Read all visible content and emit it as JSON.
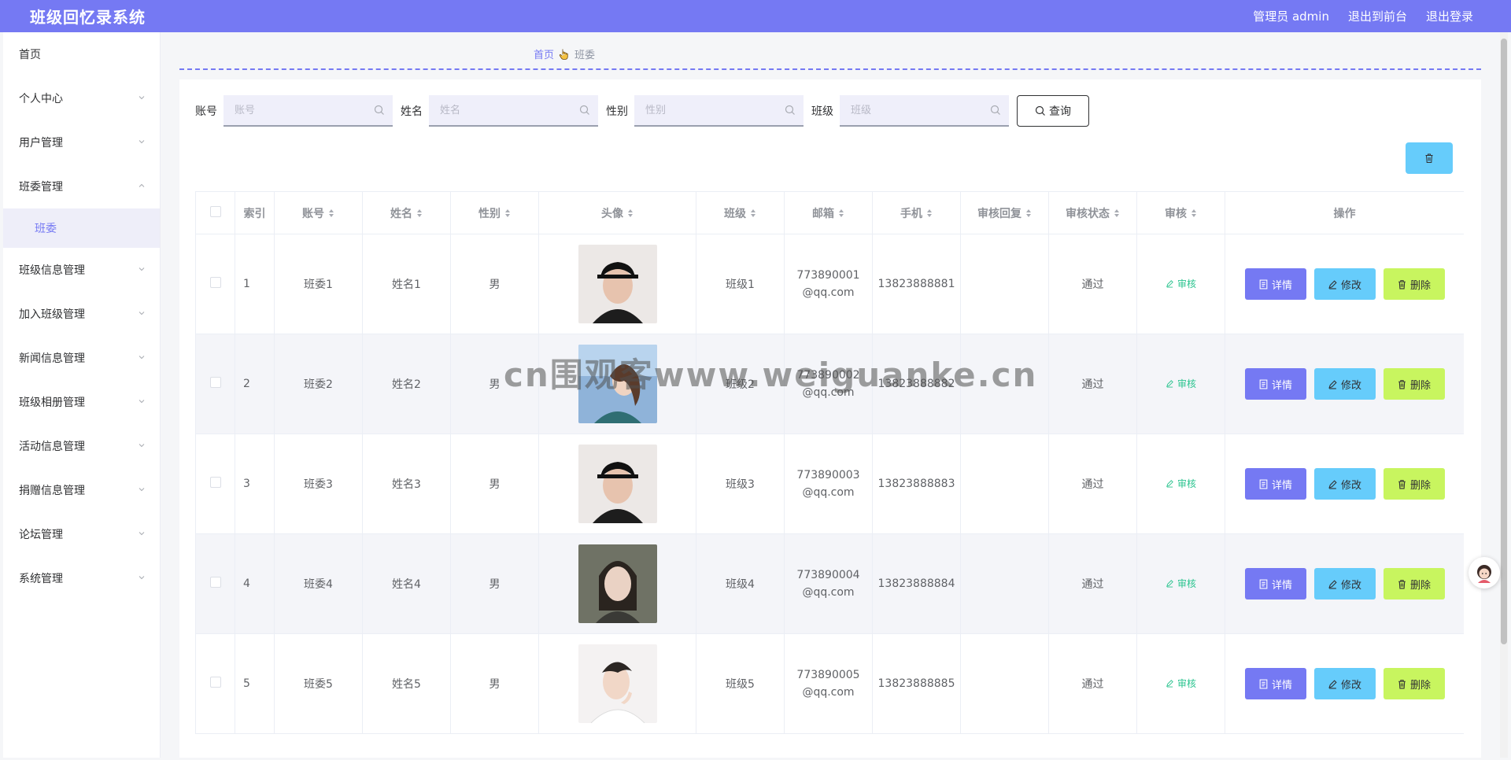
{
  "header": {
    "app_title": "班级回忆录系统",
    "admin_label": "管理员 admin",
    "to_front_label": "退出到前台",
    "logout_label": "退出登录"
  },
  "sidebar": {
    "items": [
      {
        "label": "首页",
        "expandable": false
      },
      {
        "label": "个人中心",
        "expandable": true
      },
      {
        "label": "用户管理",
        "expandable": true
      },
      {
        "label": "班委管理",
        "expandable": true,
        "expanded": true,
        "children": [
          {
            "label": "班委",
            "active": true
          }
        ]
      },
      {
        "label": "班级信息管理",
        "expandable": true
      },
      {
        "label": "加入班级管理",
        "expandable": true
      },
      {
        "label": "新闻信息管理",
        "expandable": true
      },
      {
        "label": "班级相册管理",
        "expandable": true
      },
      {
        "label": "活动信息管理",
        "expandable": true
      },
      {
        "label": "捐赠信息管理",
        "expandable": true
      },
      {
        "label": "论坛管理",
        "expandable": true
      },
      {
        "label": "系统管理",
        "expandable": true
      }
    ]
  },
  "breadcrumb": {
    "home": "首页",
    "current": "班委"
  },
  "search": {
    "fields": [
      {
        "label": "账号",
        "placeholder": "账号"
      },
      {
        "label": "姓名",
        "placeholder": "姓名"
      },
      {
        "label": "性别",
        "placeholder": "性别"
      },
      {
        "label": "班级",
        "placeholder": "班级"
      }
    ],
    "button_label": "查询"
  },
  "table": {
    "columns": [
      "索引",
      "账号",
      "姓名",
      "性别",
      "头像",
      "班级",
      "邮箱",
      "手机",
      "审核回复",
      "审核状态",
      "审核",
      "操作"
    ],
    "rows": [
      {
        "index": "1",
        "account": "班委1",
        "name": "姓名1",
        "gender": "男",
        "class": "班级1",
        "email": "773890001@qq.com",
        "phone": "13823888881",
        "reply": "",
        "status": "通过",
        "audit": "审核"
      },
      {
        "index": "2",
        "account": "班委2",
        "name": "姓名2",
        "gender": "男",
        "class": "班级2",
        "email": "773890002@qq.com",
        "phone": "13823888882",
        "reply": "",
        "status": "通过",
        "audit": "审核"
      },
      {
        "index": "3",
        "account": "班委3",
        "name": "姓名3",
        "gender": "男",
        "class": "班级3",
        "email": "773890003@qq.com",
        "phone": "13823888883",
        "reply": "",
        "status": "通过",
        "audit": "审核"
      },
      {
        "index": "4",
        "account": "班委4",
        "name": "姓名4",
        "gender": "男",
        "class": "班级4",
        "email": "773890004@qq.com",
        "phone": "13823888884",
        "reply": "",
        "status": "通过",
        "audit": "审核"
      },
      {
        "index": "5",
        "account": "班委5",
        "name": "姓名5",
        "gender": "男",
        "class": "班级5",
        "email": "773890005@qq.com",
        "phone": "13823888885",
        "reply": "",
        "status": "通过",
        "audit": "审核"
      }
    ],
    "actions": {
      "detail": "详情",
      "edit": "修改",
      "delete": "删除"
    }
  },
  "watermark": "cn围观客www.weiguanke.cn",
  "colors": {
    "primary": "#7579f3",
    "edit": "#66ccfb",
    "delete": "#c8f55f",
    "audit_link": "#2bc48f"
  }
}
